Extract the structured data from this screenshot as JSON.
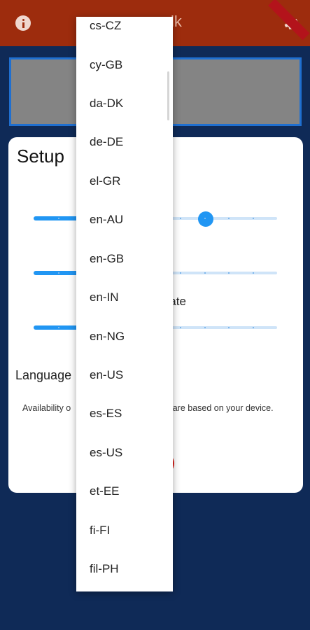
{
  "appbar": {
    "title_partial": "lk",
    "info_icon": "info-icon",
    "settings_icon": "gear-icon",
    "ribbon_color": "#b3131b"
  },
  "colors": {
    "appbar": "#9d2c0d",
    "background": "#0f2a57",
    "accent": "#2196f3",
    "text_box": "#848484"
  },
  "dialog": {
    "title": "Setup",
    "labels": {
      "rate_suffix": "e",
      "rate2_suffix": "Rate",
      "language": "Language"
    },
    "availability_text": "Availability o",
    "availability_text_right": "s are based on your device."
  },
  "sliders": [
    {
      "name": "volume",
      "value": 0.5
    },
    {
      "name": "pitch",
      "value": 0.5
    },
    {
      "name": "speech-rate",
      "value": 0.5
    }
  ],
  "language_dropdown": {
    "items": [
      "cs-CZ",
      "cy-GB",
      "da-DK",
      "de-DE",
      "el-GR",
      "en-AU",
      "en-GB",
      "en-IN",
      "en-NG",
      "en-US",
      "es-ES",
      "es-US",
      "et-EE",
      "fi-FI",
      "fil-PH"
    ]
  }
}
